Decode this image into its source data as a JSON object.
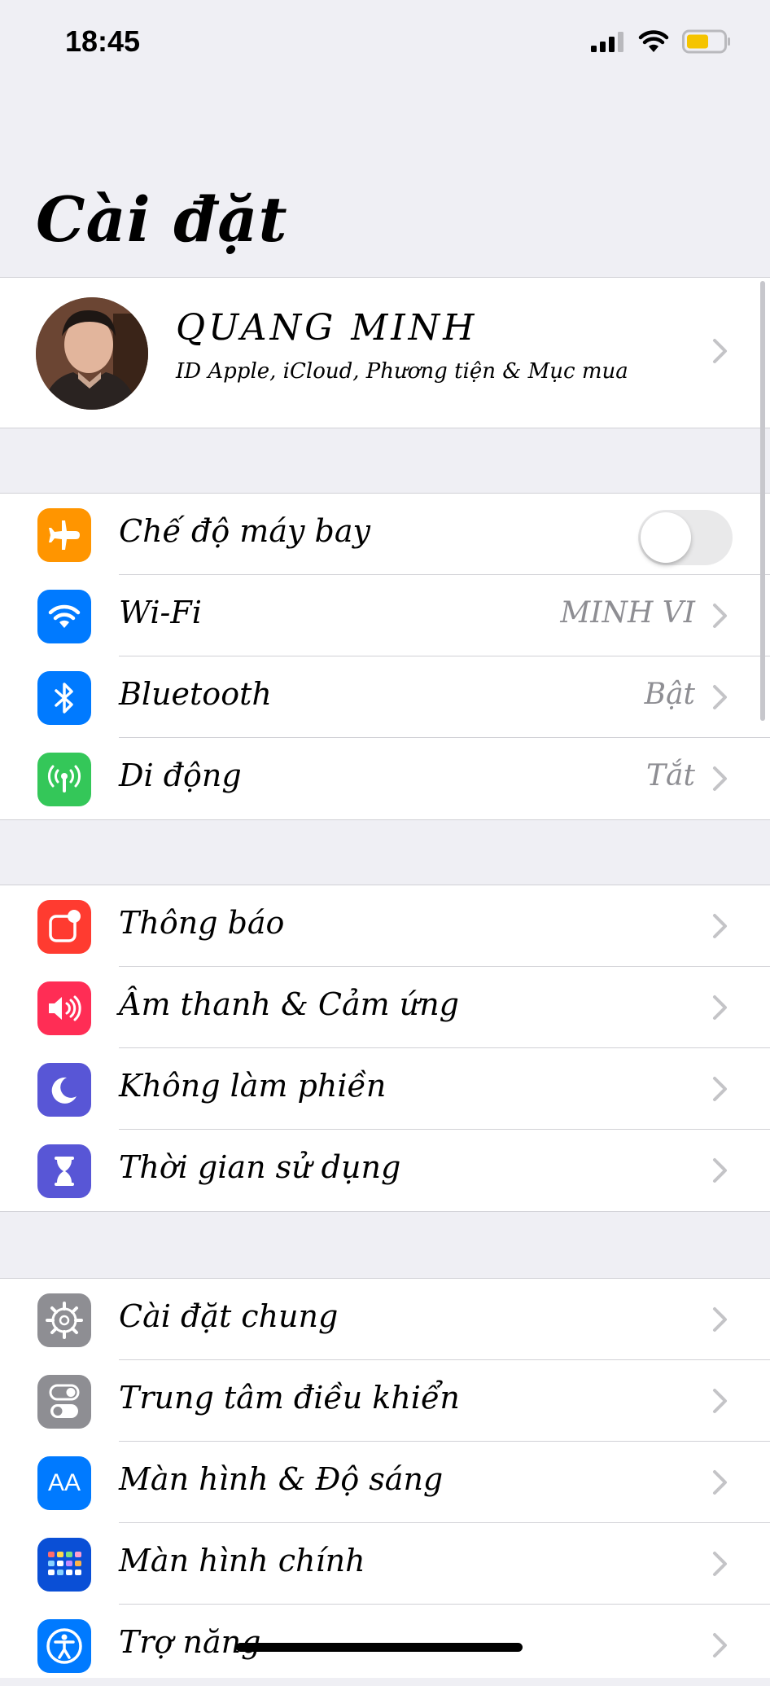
{
  "statusbar": {
    "time": "18:45",
    "battery_color": "#f5c400"
  },
  "page_title": "Cài đặt",
  "profile": {
    "name": "QUANG MINH",
    "subtitle": "ID Apple, iCloud, Phương tiện & Mục mua"
  },
  "group1": [
    {
      "label": "Chế độ máy bay",
      "icon": "airplane-icon",
      "color": "#ff9500",
      "toggle": false
    },
    {
      "label": "Wi-Fi",
      "value": "MINH VI",
      "icon": "wifi-icon",
      "color": "#007aff"
    },
    {
      "label": "Bluetooth",
      "value": "Bật",
      "icon": "bluetooth-icon",
      "color": "#007aff"
    },
    {
      "label": "Di động",
      "value": "Tắt",
      "icon": "cellular-icon",
      "color": "#34c759"
    }
  ],
  "group2": [
    {
      "label": "Thông báo",
      "icon": "notifications-icon",
      "color": "#ff3b30"
    },
    {
      "label": "Âm thanh & Cảm ứng",
      "icon": "sound-icon",
      "color": "#ff2d55"
    },
    {
      "label": "Không làm phiền",
      "icon": "moon-icon",
      "color": "#5856d6"
    },
    {
      "label": "Thời gian sử dụng",
      "icon": "hourglass-icon",
      "color": "#5856d6"
    }
  ],
  "group3": [
    {
      "label": "Cài đặt chung",
      "icon": "gear-icon",
      "color": "#8e8e93"
    },
    {
      "label": "Trung tâm điều khiển",
      "icon": "control-center-icon",
      "color": "#8e8e93"
    },
    {
      "label": "Màn hình & Độ sáng",
      "icon": "display-brightness-icon",
      "icon_text": "AA",
      "color": "#007aff"
    },
    {
      "label": "Màn hình chính",
      "icon": "home-screen-icon",
      "color": "#0a4fd6"
    },
    {
      "label": "Trợ năng",
      "icon": "accessibility-icon",
      "color": "#007aff"
    }
  ]
}
